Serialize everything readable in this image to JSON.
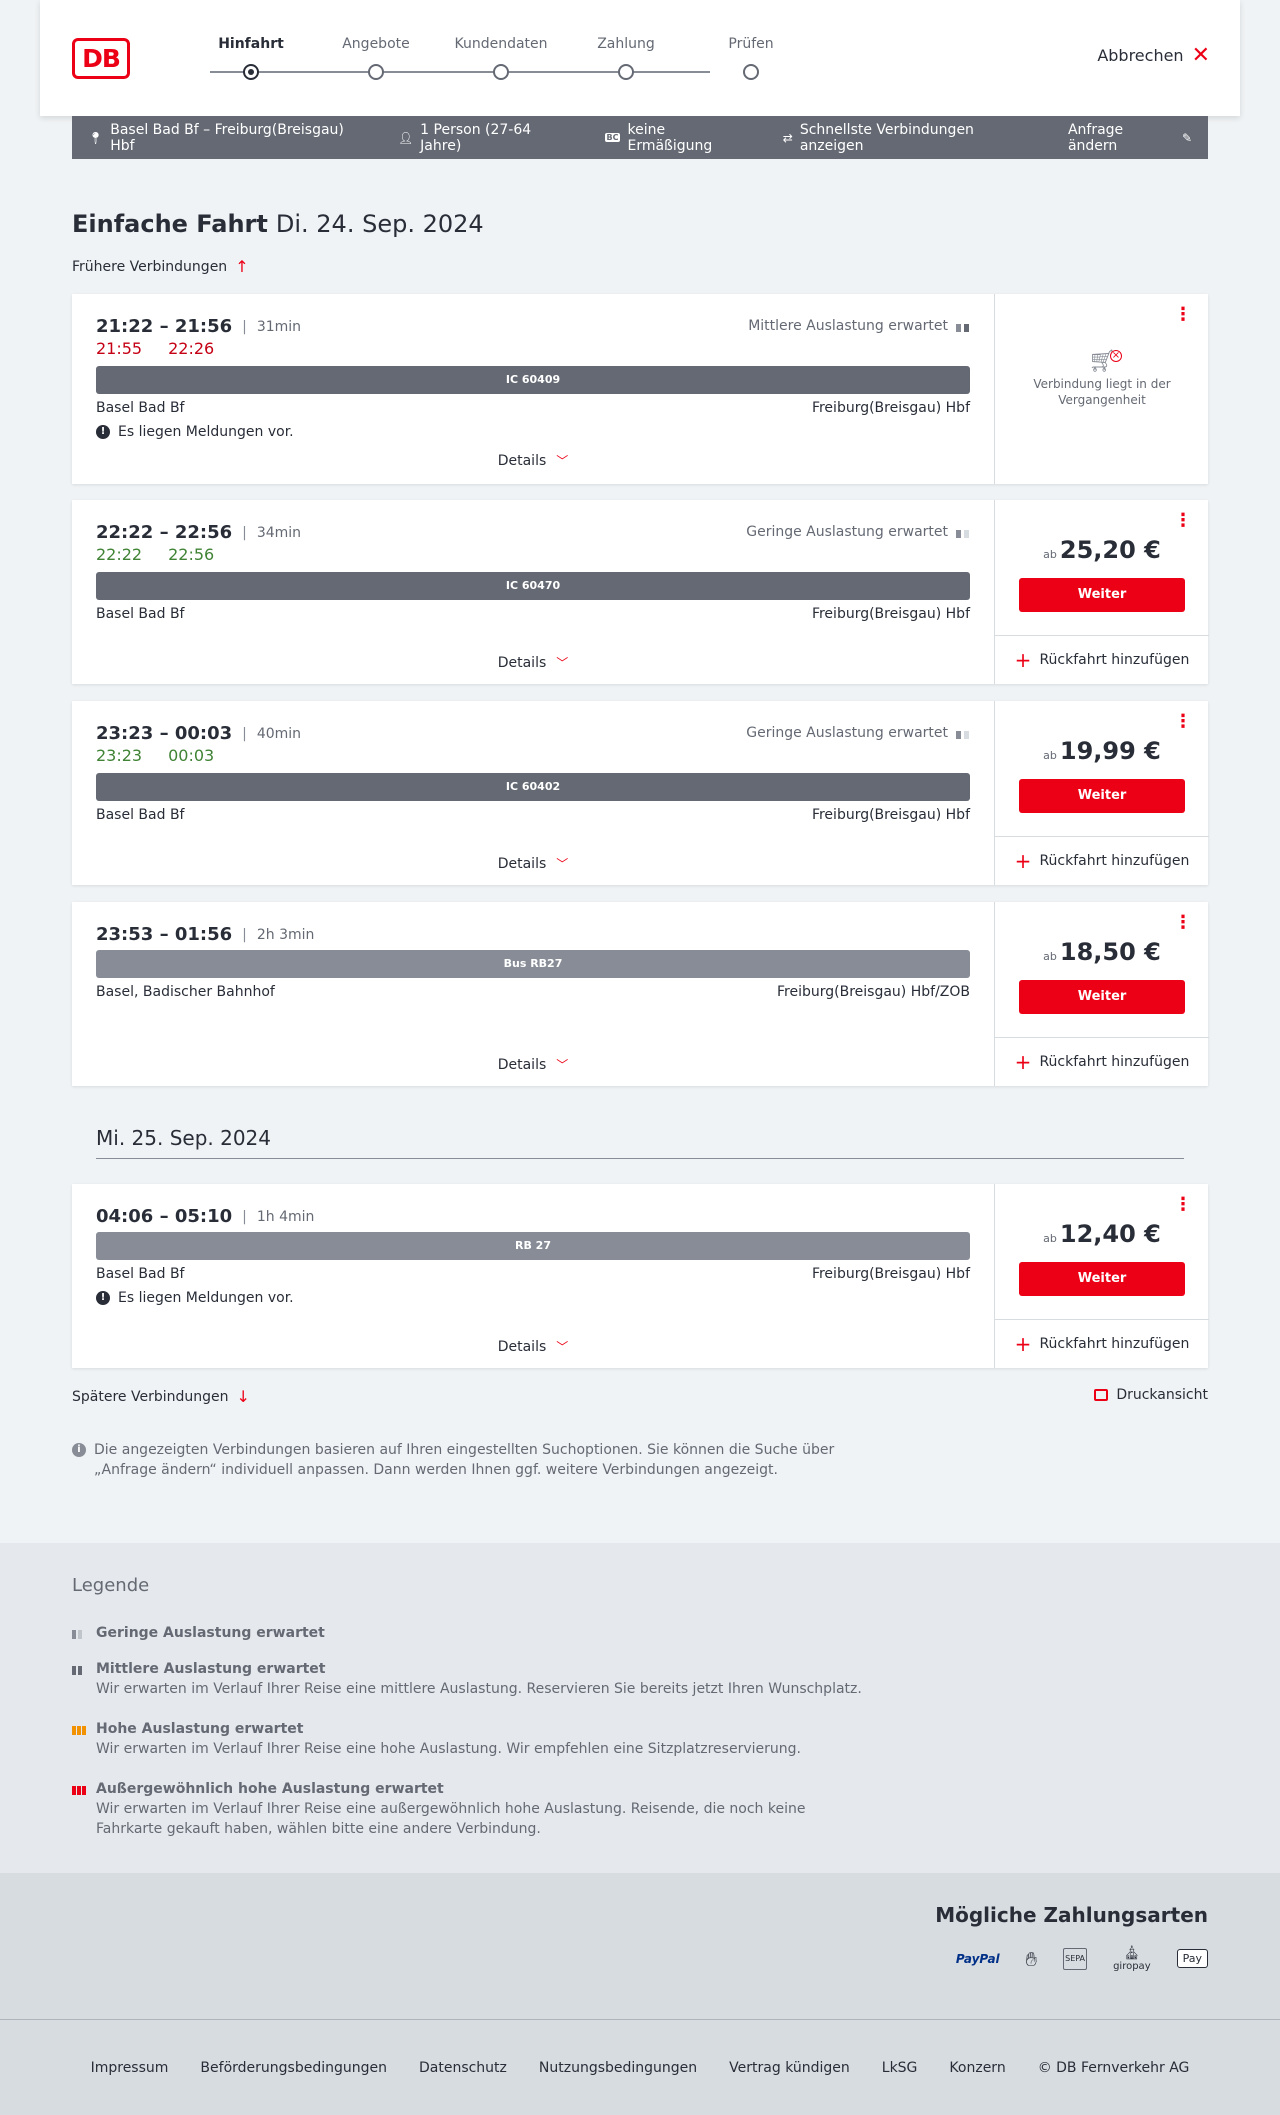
{
  "header": {
    "logo": "DB",
    "steps": [
      "Hinfahrt",
      "Angebote",
      "Kundendaten",
      "Zahlung",
      "Prüfen"
    ],
    "active_step": "Hinfahrt",
    "cancel_label": "Abbrechen"
  },
  "summary": {
    "route": "Basel Bad Bf – Freiburg(Breisgau) Hbf",
    "passengers": "1 Person (27-64 Jahre)",
    "discount_badge": "BC",
    "discount": "keine Ermäßigung",
    "option": "Schnellste Verbindungen anzeigen",
    "change": "Anfrage ändern"
  },
  "title": {
    "main": "Einfache Fahrt",
    "date": "Di. 24. Sep. 2024"
  },
  "earlier_label": "Frühere Verbindungen",
  "details_label": "Details",
  "weiter_label": "Weiter",
  "return_label": "Rückfahrt hinzufügen",
  "price_prefix": "ab",
  "message_text": "Es liegen Meldungen vor.",
  "connections": [
    {
      "times": "21:22 – 21:56",
      "duration": "31min",
      "occupancy": "Mittlere Auslastung erwartet",
      "rt_dep": "21:55",
      "rt_arr": "22:26",
      "train": "IC 60409",
      "from": "Basel Bad Bf",
      "to": "Freiburg(Breisgau) Hbf",
      "past_text": "Verbindung liegt in der Vergangenheit"
    },
    {
      "times": "22:22 – 22:56",
      "duration": "34min",
      "occupancy": "Geringe Auslastung erwartet",
      "rt_dep": "22:22",
      "rt_arr": "22:56",
      "train": "IC 60470",
      "from": "Basel Bad Bf",
      "to": "Freiburg(Breisgau) Hbf",
      "price": "25,20 €"
    },
    {
      "times": "23:23 – 00:03",
      "duration": "40min",
      "occupancy": "Geringe Auslastung erwartet",
      "rt_dep": "23:23",
      "rt_arr": "00:03",
      "train": "IC 60402",
      "from": "Basel Bad Bf",
      "to": "Freiburg(Breisgau) Hbf",
      "price": "19,99 €"
    },
    {
      "times": "23:53 – 01:56",
      "duration": "2h 3min",
      "train": "Bus RB27",
      "from": "Basel, Badischer Bahnhof",
      "to": "Freiburg(Breisgau) Hbf/ZOB",
      "price": "18,50 €"
    },
    {
      "times": "04:06 – 05:10",
      "duration": "1h 4min",
      "train": "RB 27",
      "from": "Basel Bad Bf",
      "to": "Freiburg(Breisgau) Hbf",
      "price": "12,40 €"
    }
  ],
  "next_day": "Mi. 25. Sep. 2024",
  "later_label": "Spätere Verbindungen",
  "print_label": "Druckansicht",
  "info_text": "Die angezeigten Verbindungen basieren auf Ihren eingestellten Suchoptionen. Sie können die Suche über „Anfrage ändern“ individuell anpassen. Dann werden Ihnen ggf. weitere Verbindungen angezeigt.",
  "legend": {
    "title": "Legende",
    "items": [
      {
        "title": "Geringe Auslastung erwartet",
        "desc": ""
      },
      {
        "title": "Mittlere Auslastung erwartet",
        "desc": "Wir erwarten im Verlauf Ihrer Reise eine mittlere Auslastung. Reservieren Sie bereits jetzt Ihren Wunschplatz."
      },
      {
        "title": "Hohe Auslastung erwartet",
        "desc": "Wir erwarten im Verlauf Ihrer Reise eine hohe Auslastung. Wir empfehlen eine Sitzplatzreservierung."
      },
      {
        "title": "Außergewöhnlich hohe Auslastung erwartet",
        "desc": "Wir erwarten im Verlauf Ihrer Reise eine außergewöhnlich hohe Auslastung. Reisende, die noch keine Fahrkarte gekauft haben, wählen bitte eine andere Verbindung."
      }
    ],
    "colors": {
      "low": "#878c96",
      "high": "#f39200",
      "extreme": "#ec0016"
    }
  },
  "payments": {
    "title": "Mögliche Zahlungsarten",
    "paypal": "PayPal",
    "sepa": "SEPA",
    "giropay": "giropay",
    "applepay": "Pay"
  },
  "footer": [
    "Impressum",
    "Beförderungsbedingungen",
    "Datenschutz",
    "Nutzungsbedingungen",
    "Vertrag kündigen",
    "LkSG",
    "Konzern",
    "© DB Fernverkehr AG"
  ],
  "colors": {
    "brand_red": "#ec0016",
    "late_red": "#c50014",
    "ontime_green": "#408335",
    "bar_gray": "#646973"
  }
}
